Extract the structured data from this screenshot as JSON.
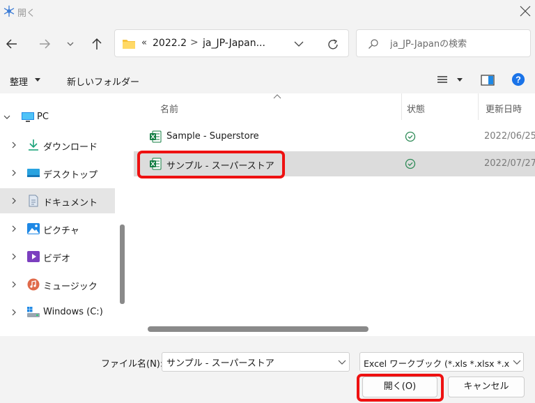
{
  "window": {
    "title": "開く",
    "app_icon": "snowflake-app-icon",
    "close_icon": "close-icon"
  },
  "nav": {
    "back_icon": "arrow-left-icon",
    "forward_icon": "arrow-right-icon",
    "recent_icon": "chevron-down-icon",
    "up_icon": "arrow-up-icon",
    "address": {
      "folder_icon": "folder-icon",
      "overflow": "«",
      "crumbs": [
        "2022.2",
        "ja_JP-Japan..."
      ],
      "separator": ">"
    },
    "refresh_icon": "refresh-icon",
    "search_placeholder": "ja_JP-Japanの検索"
  },
  "toolbar": {
    "organize_label": "整理",
    "new_folder_label": "新しいフォルダー",
    "view_icon": "view-menu-icon",
    "preview_icon": "preview-pane-icon",
    "help_icon": "help-icon"
  },
  "sidebar": {
    "items": [
      {
        "label": "PC",
        "icon": "pc-icon",
        "expanded": true
      },
      {
        "label": "ダウンロード",
        "icon": "download-icon"
      },
      {
        "label": "デスクトップ",
        "icon": "desktop-icon"
      },
      {
        "label": "ドキュメント",
        "icon": "documents-icon",
        "selected": true
      },
      {
        "label": "ピクチャ",
        "icon": "pictures-icon"
      },
      {
        "label": "ビデオ",
        "icon": "videos-icon"
      },
      {
        "label": "ミュージック",
        "icon": "music-icon"
      },
      {
        "label": "Windows (C:)",
        "icon": "drive-icon"
      }
    ]
  },
  "filelist": {
    "columns": [
      "名前",
      "状態",
      "更新日時"
    ],
    "rows": [
      {
        "name": "Sample - Superstore",
        "status_icon": "synced-check-icon",
        "date": "2022/06/25",
        "selected": false
      },
      {
        "name": "サンプル - スーパーストア",
        "status_icon": "synced-check-icon",
        "date": "2022/07/27",
        "selected": true
      }
    ]
  },
  "bottom": {
    "filename_label": "ファイル名(N):",
    "filename_value": "サンプル - スーパーストア",
    "filetype_value": "Excel ワークブック (*.xls *.xlsx *.xlsm",
    "open_label": "開く(O)",
    "cancel_label": "キャンセル"
  },
  "colors": {
    "highlight": "#ee1111",
    "accent": "#0067c0",
    "excel_green": "#107c41"
  }
}
